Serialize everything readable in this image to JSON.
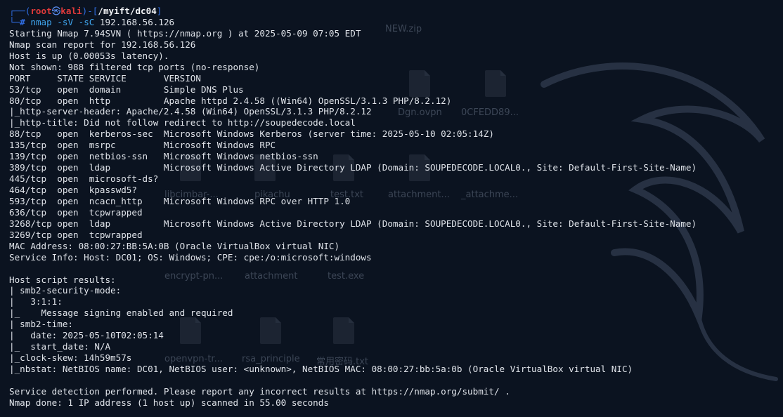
{
  "prompt": {
    "user": "root",
    "at": "㉿",
    "host": "kali",
    "path": "/myift/dc04",
    "symbol": "#"
  },
  "command": {
    "name": "nmap",
    "flags": "-sV -sC",
    "target": "192.168.56.126"
  },
  "output": [
    "Starting Nmap 7.94SVN ( https://nmap.org ) at 2025-05-09 07:05 EDT",
    "Nmap scan report for 192.168.56.126",
    "Host is up (0.00053s latency).",
    "Not shown: 988 filtered tcp ports (no-response)",
    "PORT     STATE SERVICE       VERSION",
    "53/tcp   open  domain        Simple DNS Plus",
    "80/tcp   open  http          Apache httpd 2.4.58 ((Win64) OpenSSL/3.1.3 PHP/8.2.12)",
    "|_http-server-header: Apache/2.4.58 (Win64) OpenSSL/3.1.3 PHP/8.2.12",
    "|_http-title: Did not follow redirect to http://soupedecode.local",
    "88/tcp   open  kerberos-sec  Microsoft Windows Kerberos (server time: 2025-05-10 02:05:14Z)",
    "135/tcp  open  msrpc         Microsoft Windows RPC",
    "139/tcp  open  netbios-ssn   Microsoft Windows netbios-ssn",
    "389/tcp  open  ldap          Microsoft Windows Active Directory LDAP (Domain: SOUPEDECODE.LOCAL0., Site: Default-First-Site-Name)",
    "445/tcp  open  microsoft-ds?",
    "464/tcp  open  kpasswd5?",
    "593/tcp  open  ncacn_http    Microsoft Windows RPC over HTTP 1.0",
    "636/tcp  open  tcpwrapped",
    "3268/tcp open  ldap          Microsoft Windows Active Directory LDAP (Domain: SOUPEDECODE.LOCAL0., Site: Default-First-Site-Name)",
    "3269/tcp open  tcpwrapped",
    "MAC Address: 08:00:27:BB:5A:0B (Oracle VirtualBox virtual NIC)",
    "Service Info: Host: DC01; OS: Windows; CPE: cpe:/o:microsoft:windows",
    "",
    "Host script results:",
    "| smb2-security-mode:",
    "|   3:1:1:",
    "|_    Message signing enabled and required",
    "| smb2-time:",
    "|   date: 2025-05-10T02:05:14",
    "|_  start_date: N/A",
    "|_clock-skew: 14h59m57s",
    "|_nbstat: NetBIOS name: DC01, NetBIOS user: <unknown>, NetBIOS MAC: 08:00:27:bb:5a:0b (Oracle VirtualBox virtual NIC)",
    "",
    "Service detection performed. Please report any incorrect results at https://nmap.org/submit/ .",
    "Nmap done: 1 IP address (1 host up) scanned in 55.00 seconds"
  ],
  "desktop_labels": [
    "NEW.zip",
    "Dgn.ovpn",
    "0CFEDD89...",
    "libcimbar-...",
    "pikachu",
    "test.txt",
    "attachment...",
    "_attachme...",
    "encrypt-pn...",
    "attachment",
    "test.exe",
    "openvpn-tr...",
    "rsa_principle",
    "常用密码.txt"
  ]
}
